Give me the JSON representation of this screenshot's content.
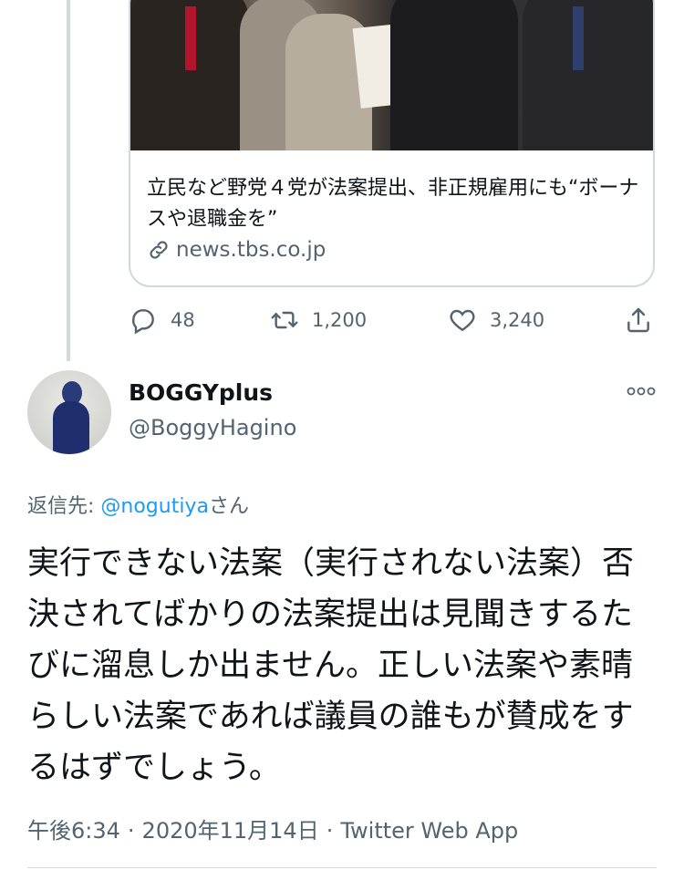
{
  "quoted_card": {
    "headline": "立民など野党４党が法案提出、非正規雇用にも“ボーナスや退職金を”",
    "url": "news.tbs.co.jp"
  },
  "actions": {
    "reply_count": "48",
    "retweet_count": "1,200",
    "like_count": "3,240"
  },
  "author": {
    "name": "BOGGYplus",
    "handle": "@BoggyHagino"
  },
  "reply_to": {
    "prefix": "返信先: ",
    "mention": "@nogutiya",
    "suffix": "さん"
  },
  "tweet": {
    "text": "実行できない法案（実行されない法案）否決されてばかりの法案提出は見聞きするたびに溜息しか出ません。正しい法案や素晴らしい法案であれば議員の誰もが賛成をするはずでしょう。"
  },
  "meta": {
    "time": "午後6:34",
    "date": "2020年11月14日",
    "source": "Twitter Web App"
  },
  "colors": {
    "link": "#1d9bf0",
    "secondary_text": "#536471",
    "border": "#cfd9de"
  }
}
